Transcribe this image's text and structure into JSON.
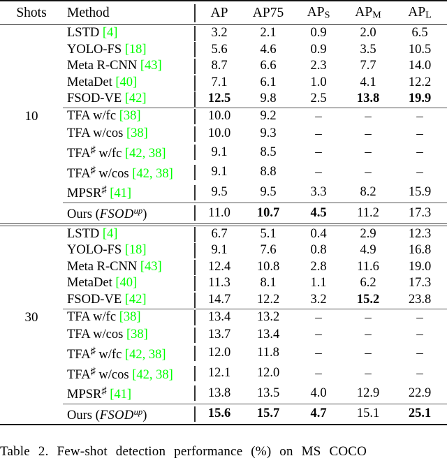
{
  "table": {
    "headers": {
      "shots": "Shots",
      "method": "Method",
      "ap": "AP",
      "ap75": "AP75",
      "aps_base": "AP",
      "aps_sub": "S",
      "apm_base": "AP",
      "apm_sub": "M",
      "apl_base": "AP",
      "apl_sub": "L"
    },
    "citation_color": "#00ff00",
    "blocks": [
      {
        "shots": "10",
        "group_a": [
          {
            "method_name": "LSTD",
            "method_sup": "",
            "method_cite": "[4]",
            "cite_nums": "4",
            "values": [
              "3.2",
              "2.1",
              "0.9",
              "2.0",
              "6.5"
            ],
            "bold": [
              false,
              false,
              false,
              false,
              false
            ]
          },
          {
            "method_name": "YOLO-FS",
            "method_sup": "",
            "method_cite": "[18]",
            "cite_nums": "18",
            "values": [
              "5.6",
              "4.6",
              "0.9",
              "3.5",
              "10.5"
            ],
            "bold": [
              false,
              false,
              false,
              false,
              false
            ]
          },
          {
            "method_name": "Meta R-CNN",
            "method_sup": "",
            "method_cite": "[43]",
            "cite_nums": "43",
            "values": [
              "8.7",
              "6.6",
              "2.3",
              "7.7",
              "14.0"
            ],
            "bold": [
              false,
              false,
              false,
              false,
              false
            ]
          },
          {
            "method_name": "MetaDet",
            "method_sup": "",
            "method_cite": "[40]",
            "cite_nums": "40",
            "values": [
              "7.1",
              "6.1",
              "1.0",
              "4.1",
              "12.2"
            ],
            "bold": [
              false,
              false,
              false,
              false,
              false
            ]
          },
          {
            "method_name": "FSOD-VE",
            "method_sup": "",
            "method_cite": "[42]",
            "cite_nums": "42",
            "values": [
              "12.5",
              "9.8",
              "2.5",
              "13.8",
              "19.9"
            ],
            "bold": [
              true,
              false,
              false,
              true,
              true
            ]
          }
        ],
        "group_b": [
          {
            "method_name": "TFA w/fc",
            "method_sup": "",
            "method_cite": "[38]",
            "cite_nums": "38",
            "values": [
              "10.0",
              "9.2",
              "–",
              "–",
              "–"
            ],
            "bold": [
              false,
              false,
              false,
              false,
              false
            ]
          },
          {
            "method_name": "TFA w/cos",
            "method_sup": "",
            "method_cite": "[38]",
            "cite_nums": "38",
            "values": [
              "10.0",
              "9.3",
              "–",
              "–",
              "–"
            ],
            "bold": [
              false,
              false,
              false,
              false,
              false
            ]
          },
          {
            "method_name": "TFA",
            "method_sup": "♯",
            "method_tail": " w/fc",
            "method_cite": "[42, 38]",
            "cite_nums": "42, 38",
            "values": [
              "9.1",
              "8.5",
              "–",
              "–",
              "–"
            ],
            "bold": [
              false,
              false,
              false,
              false,
              false
            ]
          },
          {
            "method_name": "TFA",
            "method_sup": "♯",
            "method_tail": " w/cos",
            "method_cite": "[42, 38]",
            "cite_nums": "42, 38",
            "values": [
              "9.1",
              "8.8",
              "–",
              "–",
              "–"
            ],
            "bold": [
              false,
              false,
              false,
              false,
              false
            ]
          },
          {
            "method_name": "MPSR",
            "method_sup": "♯",
            "method_tail": "",
            "method_cite": "[41]",
            "cite_nums": "41",
            "values": [
              "9.5",
              "9.5",
              "3.3",
              "8.2",
              "15.9"
            ],
            "bold": [
              false,
              false,
              false,
              false,
              false
            ]
          }
        ],
        "ours": {
          "label_prefix": "Ours (",
          "label_math": "FSOD",
          "label_sup": "up",
          "label_suffix": ")",
          "values": [
            "11.0",
            "10.7",
            "4.5",
            "11.2",
            "17.3"
          ],
          "bold": [
            false,
            true,
            true,
            false,
            false
          ]
        }
      },
      {
        "shots": "30",
        "group_a": [
          {
            "method_name": "LSTD",
            "method_sup": "",
            "method_cite": "[4]",
            "cite_nums": "4",
            "values": [
              "6.7",
              "5.1",
              "0.4",
              "2.9",
              "12.3"
            ],
            "bold": [
              false,
              false,
              false,
              false,
              false
            ]
          },
          {
            "method_name": "YOLO-FS",
            "method_sup": "",
            "method_cite": "[18]",
            "cite_nums": "18",
            "values": [
              "9.1",
              "7.6",
              "0.8",
              "4.9",
              "16.8"
            ],
            "bold": [
              false,
              false,
              false,
              false,
              false
            ]
          },
          {
            "method_name": "Meta R-CNN",
            "method_sup": "",
            "method_cite": "[43]",
            "cite_nums": "43",
            "values": [
              "12.4",
              "10.8",
              "2.8",
              "11.6",
              "19.0"
            ],
            "bold": [
              false,
              false,
              false,
              false,
              false
            ]
          },
          {
            "method_name": "MetaDet",
            "method_sup": "",
            "method_cite": "[40]",
            "cite_nums": "40",
            "values": [
              "11.3",
              "8.1",
              "1.1",
              "6.2",
              "17.3"
            ],
            "bold": [
              false,
              false,
              false,
              false,
              false
            ]
          },
          {
            "method_name": "FSOD-VE",
            "method_sup": "",
            "method_cite": "[42]",
            "cite_nums": "42",
            "values": [
              "14.7",
              "12.2",
              "3.2",
              "15.2",
              "23.8"
            ],
            "bold": [
              false,
              false,
              false,
              true,
              false
            ]
          }
        ],
        "group_b": [
          {
            "method_name": "TFA w/fc",
            "method_sup": "",
            "method_cite": "[38]",
            "cite_nums": "38",
            "values": [
              "13.4",
              "13.2",
              "–",
              "–",
              "–"
            ],
            "bold": [
              false,
              false,
              false,
              false,
              false
            ]
          },
          {
            "method_name": "TFA w/cos",
            "method_sup": "",
            "method_cite": "[38]",
            "cite_nums": "38",
            "values": [
              "13.7",
              "13.4",
              "–",
              "–",
              "–"
            ],
            "bold": [
              false,
              false,
              false,
              false,
              false
            ]
          },
          {
            "method_name": "TFA",
            "method_sup": "♯",
            "method_tail": " w/fc",
            "method_cite": "[42, 38]",
            "cite_nums": "42, 38",
            "values": [
              "12.0",
              "11.8",
              "–",
              "–",
              "–"
            ],
            "bold": [
              false,
              false,
              false,
              false,
              false
            ]
          },
          {
            "method_name": "TFA",
            "method_sup": "♯",
            "method_tail": " w/cos",
            "method_cite": "[42, 38]",
            "cite_nums": "42, 38",
            "values": [
              "12.1",
              "12.0",
              "–",
              "–",
              "–"
            ],
            "bold": [
              false,
              false,
              false,
              false,
              false
            ]
          },
          {
            "method_name": "MPSR",
            "method_sup": "♯",
            "method_tail": "",
            "method_cite": "[41]",
            "cite_nums": "41",
            "values": [
              "13.8",
              "13.5",
              "4.0",
              "12.9",
              "22.9"
            ],
            "bold": [
              false,
              false,
              false,
              false,
              false
            ]
          }
        ],
        "ours": {
          "label_prefix": "Ours (",
          "label_math": "FSOD",
          "label_sup": "up",
          "label_suffix": ")",
          "values": [
            "15.6",
            "15.7",
            "4.7",
            "15.1",
            "25.1"
          ],
          "bold": [
            true,
            true,
            true,
            false,
            true
          ]
        }
      }
    ]
  },
  "caption": {
    "text": "Table 2. Few-shot detection performance (%) on MS COCO"
  }
}
